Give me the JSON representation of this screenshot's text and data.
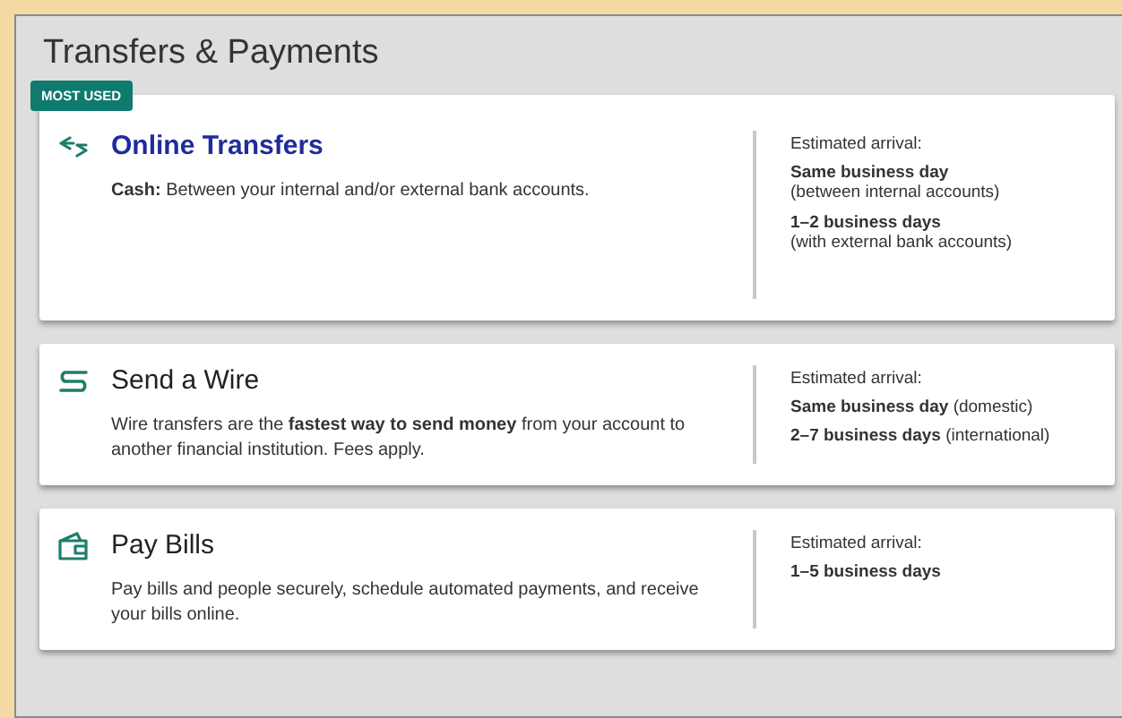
{
  "panel": {
    "title": "Transfers & Payments"
  },
  "cards": [
    {
      "kind": "transfer",
      "badge": "MOST USED",
      "link": true,
      "title": "Online Transfers",
      "description": "**Cash:** Between your internal and/or external bank accounts.",
      "arrival_label": "Estimated arrival:",
      "entries": [
        {
          "kind": "stacked",
          "text": "Same business day",
          "note": "(between internal accounts)"
        },
        {
          "kind": "stacked",
          "text": "1–2 business days",
          "note": "(with external bank accounts)"
        }
      ]
    },
    {
      "kind": "wire",
      "link": false,
      "title": "Send a Wire",
      "description": "Wire transfers are the **fastest way to send money** from your account to another financial institution. Fees apply.",
      "arrival_label": "Estimated arrival:",
      "entries": [
        {
          "kind": "inline",
          "text": "**Same business day** (domestic)"
        },
        {
          "kind": "inline",
          "text": "**2–7 business days** (international)"
        }
      ]
    },
    {
      "kind": "wallet",
      "link": false,
      "title": "Pay Bills",
      "description": "Pay bills and people securely, schedule automated payments, and receive your bills online.",
      "arrival_label": "Estimated arrival:",
      "entries": [
        {
          "kind": "stacked",
          "text": "1–5 business days"
        }
      ]
    }
  ]
}
